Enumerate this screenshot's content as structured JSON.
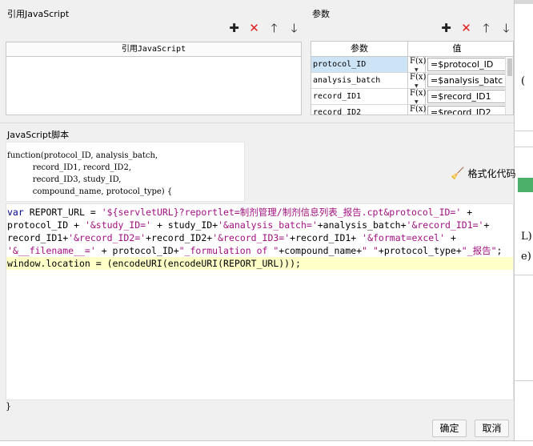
{
  "left_panel": {
    "title": "引用JavaScript",
    "table_header": "引用JavaScript"
  },
  "right_panel": {
    "title": "参数",
    "col_param": "参数",
    "col_value": "值",
    "rows": [
      {
        "name": "protocol_ID",
        "fx": "F(x)",
        "value": "=$protocol_ID"
      },
      {
        "name": "analysis_batch",
        "fx": "F(x)",
        "value": "=$analysis_batc"
      },
      {
        "name": "record_ID1",
        "fx": "F(x)",
        "value": "=$record_ID1"
      },
      {
        "name": "record_ID2",
        "fx": "F(x)",
        "value": "=$record_ID2"
      }
    ]
  },
  "toolbar_icons": [
    "plus-icon",
    "delete-icon",
    "arrow-up-icon",
    "arrow-down-icon"
  ],
  "script": {
    "title": "JavaScript脚本",
    "signature": "function(protocol_ID, analysis_batch,\n          record_ID1, record_ID2,\n          record_ID3, study_ID,\n          compound_name, protocol_type) {",
    "closing": "}",
    "format_label": "格式化代码"
  },
  "code": {
    "line1_kw": "var",
    "line1_a": " REPORT_URL = ",
    "line1_s1": "'${servletURL}?reportlet=制剂管理/制剂信息列表_报告.cpt&protocol_ID='",
    "line1_b": " +",
    "line2_a": "protocol_ID + ",
    "line2_s1": "'&study_ID='",
    "line2_b": " + study_ID+",
    "line2_s2": "'&analysis_batch='",
    "line2_c": "+analysis_batch+",
    "line2_s3": "'&record_ID1='",
    "line2_d": "+",
    "line3_a": "record_ID1+",
    "line3_s1": "'&record_ID2='",
    "line3_b": "+record_ID2+",
    "line3_s2": "'&record_ID3='",
    "line3_c": "+record_ID1+ ",
    "line3_s3": "'&format=excel'",
    "line3_d": " +",
    "line4_s1": "'&__filename__='",
    "line4_a": " + protocol_ID+",
    "line4_s2": "\"_formulation of \"",
    "line4_b": "+compound_name+",
    "line4_s3": "\" \"",
    "line4_c": "+protocol_type+",
    "line4_s4": "\"_报告\"",
    "line4_d": ";",
    "line5": "window.location = (encodeURI(encodeURI(REPORT_URL)));"
  },
  "buttons": {
    "ok": "确定",
    "cancel": "取消"
  },
  "background": {
    "frag1": "(",
    "frag2": "L)",
    "frag3": "e)"
  },
  "colors": {
    "keyword": "#00008b",
    "string": "#a01080",
    "highlight": "#ffffc8",
    "selected_row": "#cde4f7",
    "delete": "#e02020"
  }
}
